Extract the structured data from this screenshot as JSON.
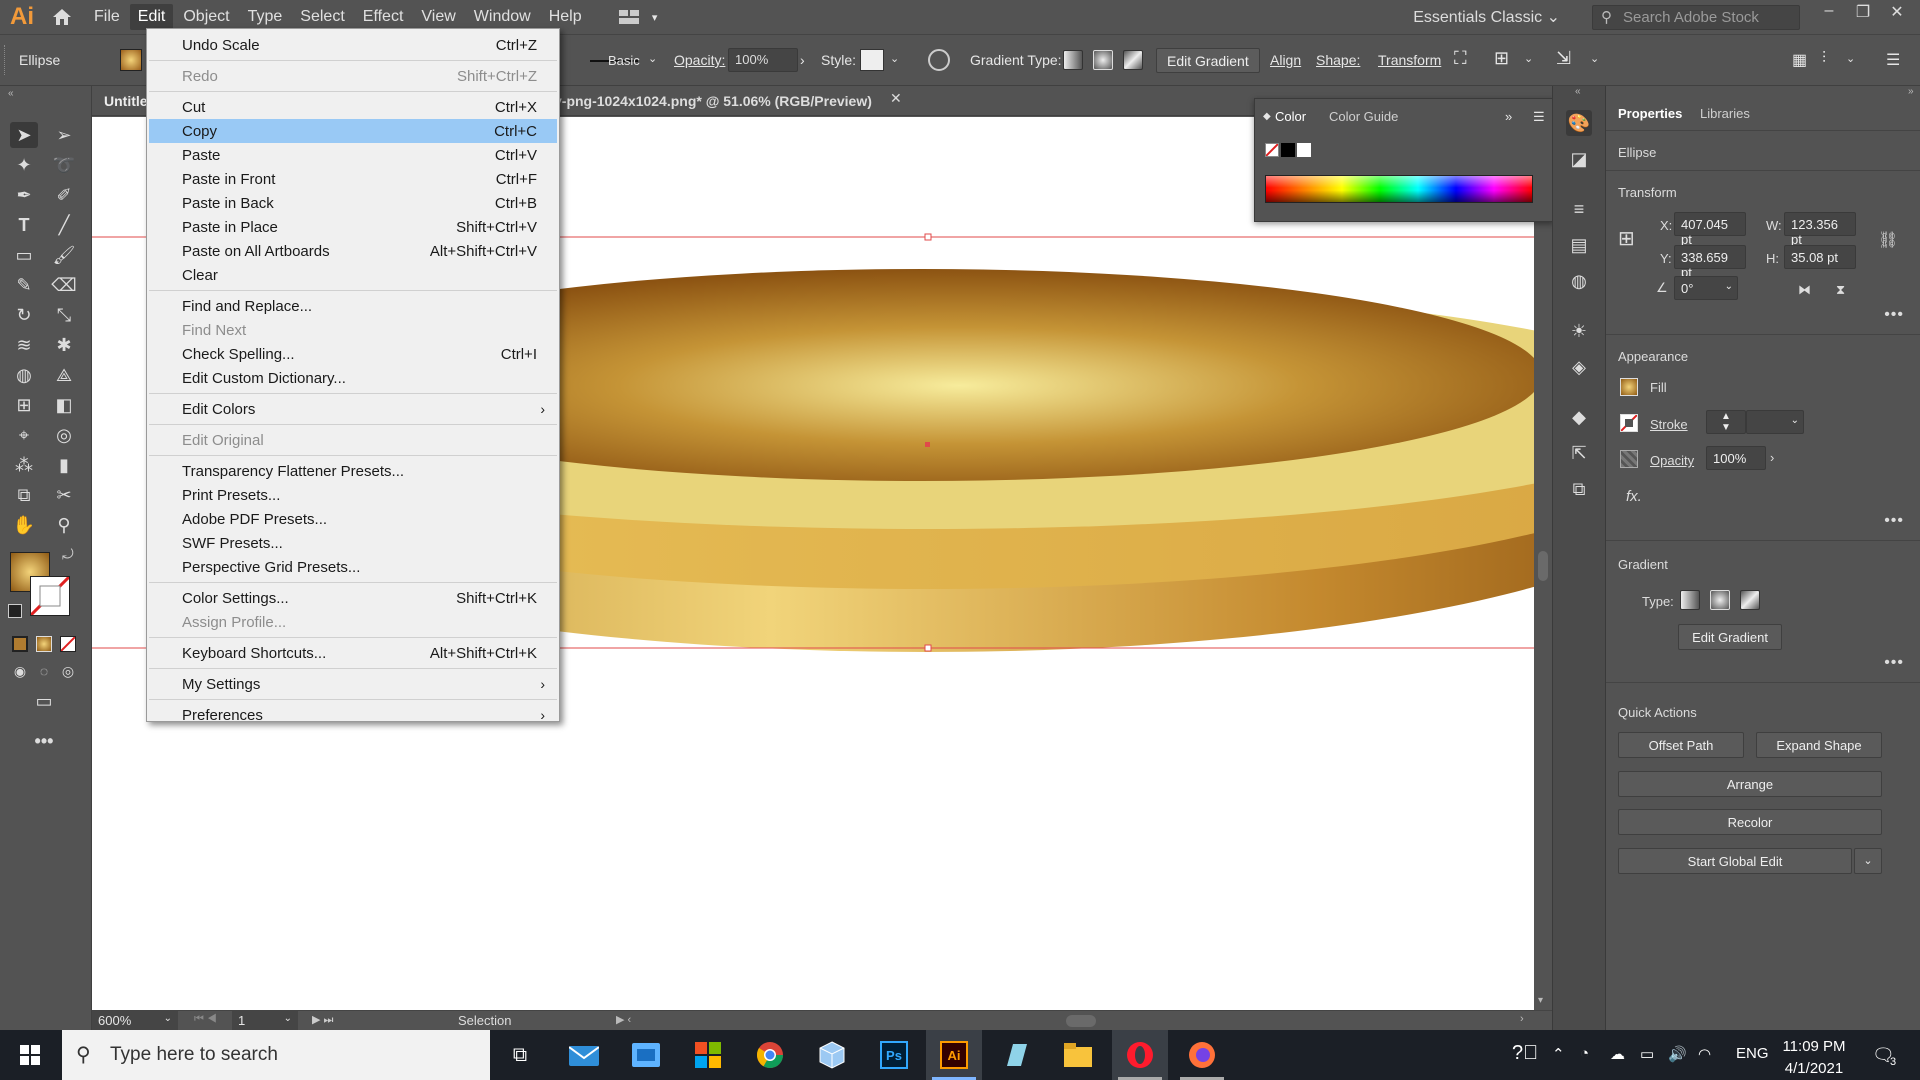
{
  "app": {
    "logo": "Ai",
    "workspace": "Essentials Classic",
    "search_placeholder": "Search Adobe Stock"
  },
  "menubar": {
    "items": [
      "File",
      "Edit",
      "Object",
      "Type",
      "Select",
      "Effect",
      "View",
      "Window",
      "Help"
    ],
    "active": "Edit"
  },
  "control": {
    "object": "Ellipse",
    "brush": "Basic",
    "opacity_label": "Opacity:",
    "opacity": "100%",
    "style_label": "Style:",
    "gradient_type_label": "Gradient Type:",
    "edit_gradient": "Edit Gradient",
    "align": "Align",
    "shape": "Shape:",
    "transform": "Transform"
  },
  "document": {
    "tab_left": "Untitle",
    "tab_title": "y-png-1024x1024.png* @ 51.06% (RGB/Preview)",
    "zoom": "600%",
    "artboard": "1",
    "status": "Selection"
  },
  "edit_menu": {
    "items": [
      {
        "label": "Undo Scale",
        "shortcut": "Ctrl+Z",
        "disabled": false
      },
      {
        "label": "Redo",
        "shortcut": "Shift+Ctrl+Z",
        "disabled": true
      },
      {
        "label": "Cut",
        "shortcut": "Ctrl+X",
        "disabled": false
      },
      {
        "label": "Copy",
        "shortcut": "Ctrl+C",
        "disabled": false,
        "highlighted": true
      },
      {
        "label": "Paste",
        "shortcut": "Ctrl+V",
        "disabled": false
      },
      {
        "label": "Paste in Front",
        "shortcut": "Ctrl+F",
        "disabled": false
      },
      {
        "label": "Paste in Back",
        "shortcut": "Ctrl+B",
        "disabled": false
      },
      {
        "label": "Paste in Place",
        "shortcut": "Shift+Ctrl+V",
        "disabled": false
      },
      {
        "label": "Paste on All Artboards",
        "shortcut": "Alt+Shift+Ctrl+V",
        "disabled": false
      },
      {
        "label": "Clear",
        "shortcut": "",
        "disabled": false
      },
      {
        "label": "Find and Replace...",
        "shortcut": "",
        "disabled": false
      },
      {
        "label": "Find Next",
        "shortcut": "",
        "disabled": true
      },
      {
        "label": "Check Spelling...",
        "shortcut": "Ctrl+I",
        "disabled": false
      },
      {
        "label": "Edit Custom Dictionary...",
        "shortcut": "",
        "disabled": false
      },
      {
        "label": "Edit Colors",
        "shortcut": "",
        "disabled": false,
        "submenu": true
      },
      {
        "label": "Edit Original",
        "shortcut": "",
        "disabled": true
      },
      {
        "label": "Transparency Flattener Presets...",
        "shortcut": "",
        "disabled": false
      },
      {
        "label": "Print Presets...",
        "shortcut": "",
        "disabled": false
      },
      {
        "label": "Adobe PDF Presets...",
        "shortcut": "",
        "disabled": false
      },
      {
        "label": "SWF Presets...",
        "shortcut": "",
        "disabled": false
      },
      {
        "label": "Perspective Grid Presets...",
        "shortcut": "",
        "disabled": false
      },
      {
        "label": "Color Settings...",
        "shortcut": "Shift+Ctrl+K",
        "disabled": false
      },
      {
        "label": "Assign Profile...",
        "shortcut": "",
        "disabled": true
      },
      {
        "label": "Keyboard Shortcuts...",
        "shortcut": "Alt+Shift+Ctrl+K",
        "disabled": false
      },
      {
        "label": "My Settings",
        "shortcut": "",
        "disabled": false,
        "submenu": true
      },
      {
        "label": "Preferences",
        "shortcut": "",
        "disabled": false,
        "submenu": true
      }
    ]
  },
  "color_panel": {
    "tabs": [
      "Color",
      "Color Guide"
    ]
  },
  "properties": {
    "tabs": [
      "Properties",
      "Libraries"
    ],
    "object": "Ellipse",
    "transform_label": "Transform",
    "x_label": "X:",
    "x": "407.045 pt",
    "y_label": "Y:",
    "y": "338.659 pt",
    "w_label": "W:",
    "w": "123.356 pt",
    "h_label": "H:",
    "h": "35.08 pt",
    "angle": "0°",
    "appearance_label": "Appearance",
    "fill": "Fill",
    "stroke": "Stroke",
    "opacity_label": "Opacity",
    "opacity": "100%",
    "fx": "fx.",
    "gradient_label": "Gradient",
    "type_label": "Type:",
    "edit_gradient": "Edit Gradient",
    "quick_actions_label": "Quick Actions",
    "offset_path": "Offset Path",
    "expand_shape": "Expand Shape",
    "arrange": "Arrange",
    "recolor": "Recolor",
    "start_global_edit": "Start Global Edit"
  },
  "taskbar": {
    "search": "Type here to search",
    "lang": "ENG",
    "time": "11:09 PM",
    "date": "4/1/2021",
    "notifications": "3"
  },
  "colors": {
    "gold_light": "#f6e79a",
    "gold_dark": "#8f5a14",
    "rim": "#e8d47a",
    "menu_highlight": "#99c9f5",
    "selection": "#e04a4a"
  }
}
